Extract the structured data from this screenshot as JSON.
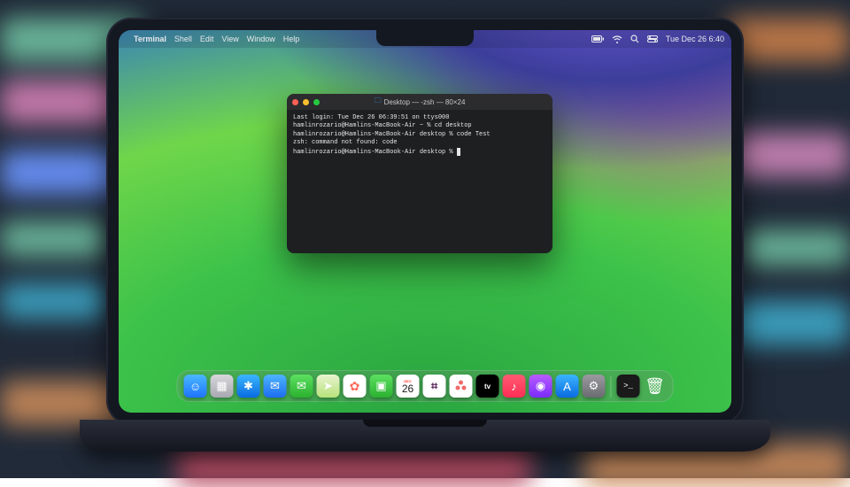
{
  "menubar": {
    "apple": "",
    "app": "Terminal",
    "items": [
      "Shell",
      "Edit",
      "View",
      "Window",
      "Help"
    ],
    "clock": "Tue Dec 26  6:40"
  },
  "terminal": {
    "title": "Desktop — -zsh — 80×24",
    "lines": [
      "Last login: Tue Dec 26 06:39:51 on ttys000",
      "hamlinrozario@Hamlins-MacBook-Air ~ % cd desktop",
      "hamlinrozario@Hamlins-MacBook-Air desktop % code Test",
      "zsh: command not found: code",
      "hamlinrozario@Hamlins-MacBook-Air desktop % "
    ]
  },
  "dock": {
    "calendar_day": "26",
    "icons": [
      {
        "name": "finder",
        "bg": "linear-gradient(#4ab8ff,#1e74ff)",
        "glyph": "☺"
      },
      {
        "name": "launchpad",
        "bg": "linear-gradient(#d7d7dc,#a8a8b0)",
        "glyph": "▦"
      },
      {
        "name": "safari",
        "bg": "linear-gradient(#3ab6ff,#0a6be0)",
        "glyph": "✱"
      },
      {
        "name": "mail",
        "bg": "linear-gradient(#4db4ff,#1d6df0)",
        "glyph": "✉"
      },
      {
        "name": "messages",
        "bg": "linear-gradient(#5ce060,#2bb030)",
        "glyph": "✉"
      },
      {
        "name": "maps",
        "bg": "linear-gradient(#e8f4d0,#b7e27a)",
        "glyph": "➤"
      },
      {
        "name": "photos",
        "bg": "#ffffff",
        "glyph": "✿"
      },
      {
        "name": "facetime",
        "bg": "linear-gradient(#5ce060,#2bb030)",
        "glyph": "▣"
      },
      {
        "name": "calendar",
        "bg": "#ffffff",
        "glyph": ""
      },
      {
        "name": "slack",
        "bg": "#ffffff",
        "glyph": "⌗"
      },
      {
        "name": "asana",
        "bg": "#ffffff",
        "glyph": "⋮"
      },
      {
        "name": "appletv",
        "bg": "#000000",
        "glyph": "tv"
      },
      {
        "name": "music",
        "bg": "linear-gradient(#ff5a72,#ff2d55)",
        "glyph": "♪"
      },
      {
        "name": "podcasts",
        "bg": "linear-gradient(#b85cff,#7a2cff)",
        "glyph": "◉"
      },
      {
        "name": "appstore",
        "bg": "linear-gradient(#3bb4ff,#0a6be0)",
        "glyph": "A"
      },
      {
        "name": "settings",
        "bg": "linear-gradient(#9a9aa0,#6b6b72)",
        "glyph": "⚙"
      }
    ],
    "right": [
      {
        "name": "terminal-app",
        "bg": "#1a1a1a",
        "glyph": ">_"
      },
      {
        "name": "trash",
        "bg": "transparent",
        "glyph": "🗑"
      }
    ]
  }
}
